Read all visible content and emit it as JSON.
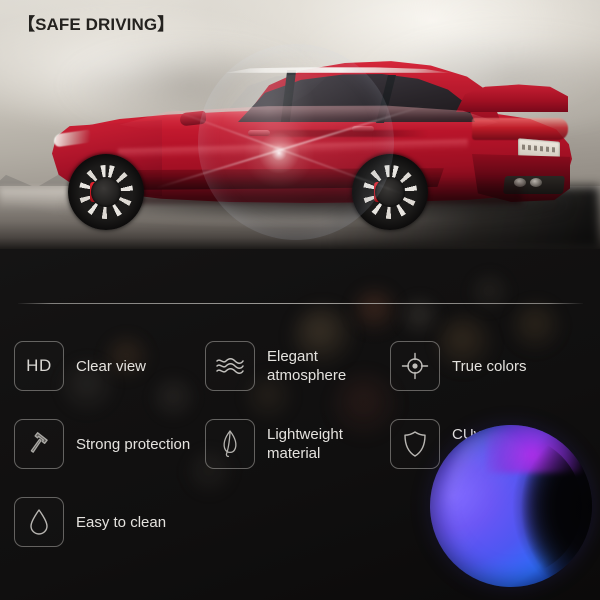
{
  "hero": {
    "title": "【SAFE DRIVING】",
    "photo_subject": "red sedan car side-rear view on hazy plain",
    "overlay": "lens-flare-circle"
  },
  "panel": {
    "divider": true,
    "features": [
      {
        "icon": "hd-icon",
        "icon_text": "HD",
        "label": "Clear view"
      },
      {
        "icon": "waves-icon",
        "icon_text": "",
        "label": "Elegant\natmosphere"
      },
      {
        "icon": "crosshair-icon",
        "icon_text": "",
        "label": "True colors"
      },
      {
        "icon": "hammer-icon",
        "icon_text": "",
        "label": "Strong protection"
      },
      {
        "icon": "leaf-icon",
        "icon_text": "",
        "label": "Lightweight\nmaterial"
      },
      {
        "icon": "shield-icon",
        "icon_text": "",
        "label": "CUv400\nprotection"
      },
      {
        "icon": "water-drop-icon",
        "icon_text": "",
        "label": "Easy to clean"
      }
    ],
    "lens_graphic": "uv-coated-lens-disc"
  },
  "colors": {
    "panel_background": "#121111",
    "hero_title_text": "#24221f",
    "feature_text": "#e4e2de",
    "icon_stroke": "#b9b7b3",
    "icon_border": "#a8a6a2",
    "divider": "#b8b6b2",
    "car_body": "#b8142a",
    "lens_violet": "#8a2fe0",
    "lens_blue": "#2a6cf8"
  }
}
